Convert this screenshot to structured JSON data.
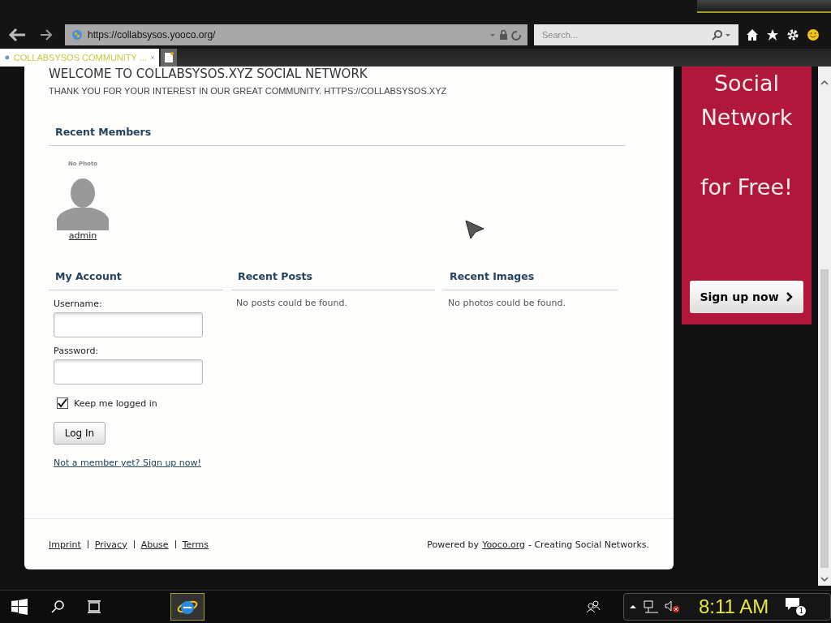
{
  "browser": {
    "address": "https://collabsysos.yooco.org/",
    "search": {
      "placeholder": "Search..."
    },
    "tabs": [
      {
        "label": "COLLABSYSOS COMMUNITY ...",
        "selected": true
      }
    ]
  },
  "page": {
    "heading": "WELCOME TO COLLABSYSOS.XYZ SOCIAL NETWORK",
    "intro": "THANK YOU FOR YOUR INTEREST IN OUR GREAT COMMUNITY. HTTPS://COLLABSYSOS.XYZ",
    "recent_members": {
      "title": "Recent Members",
      "members": [
        {
          "photo_label": "No Photo",
          "name": "admin"
        }
      ]
    },
    "my_account": {
      "title": "My Account",
      "username": {
        "label": "Username:"
      },
      "password": {
        "label": "Password:"
      },
      "keep_logged_in": {
        "label": "Keep me logged in",
        "checked": true
      },
      "login_button": "Log In",
      "signup_link": "Not a member yet? Sign up now!"
    },
    "recent_posts": {
      "title": "Recent Posts",
      "empty": "No posts could be found."
    },
    "recent_images": {
      "title": "Recent Images",
      "empty": "No photos could be found."
    },
    "footer": {
      "links": [
        "Imprint",
        "Privacy",
        "Abuse",
        "Terms"
      ],
      "powered_prefix": "Powered by",
      "powered_link": "Yooco.org",
      "powered_suffix": "- Creating Social Networks."
    }
  },
  "ad": {
    "lines": [
      "Social",
      "Network",
      "for Free!"
    ],
    "button": "Sign up now"
  },
  "taskbar": {
    "clock": "8:11 AM",
    "notifications": "1"
  }
}
